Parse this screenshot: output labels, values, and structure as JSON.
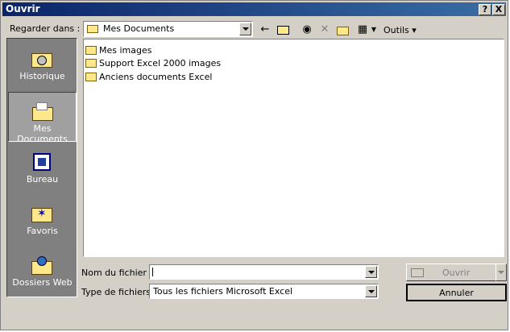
{
  "window": {
    "title": "Ouvrir",
    "help_button": "?",
    "close_button": "X"
  },
  "lookin": {
    "label": "Regarder dans :",
    "value": "Mes Documents"
  },
  "toolbar": {
    "tools_label": "Outils"
  },
  "places": [
    {
      "label": "Historique",
      "icon": "history-icon"
    },
    {
      "label": "Mes Documents",
      "icon": "my-documents-icon"
    },
    {
      "label": "Bureau",
      "icon": "desktop-icon"
    },
    {
      "label": "Favoris",
      "icon": "favorites-icon"
    },
    {
      "label": "Dossiers Web",
      "icon": "web-folders-icon"
    }
  ],
  "files": [
    {
      "name": "Mes images"
    },
    {
      "name": "Support Excel 2000 images"
    },
    {
      "name": "Anciens documents Excel"
    }
  ],
  "filename": {
    "label": "Nom du fichier :",
    "value": ""
  },
  "filetype": {
    "label": "Type de fichiers :",
    "value": "Tous les fichiers Microsoft Excel"
  },
  "buttons": {
    "open": "Ouvrir",
    "cancel": "Annuler"
  }
}
